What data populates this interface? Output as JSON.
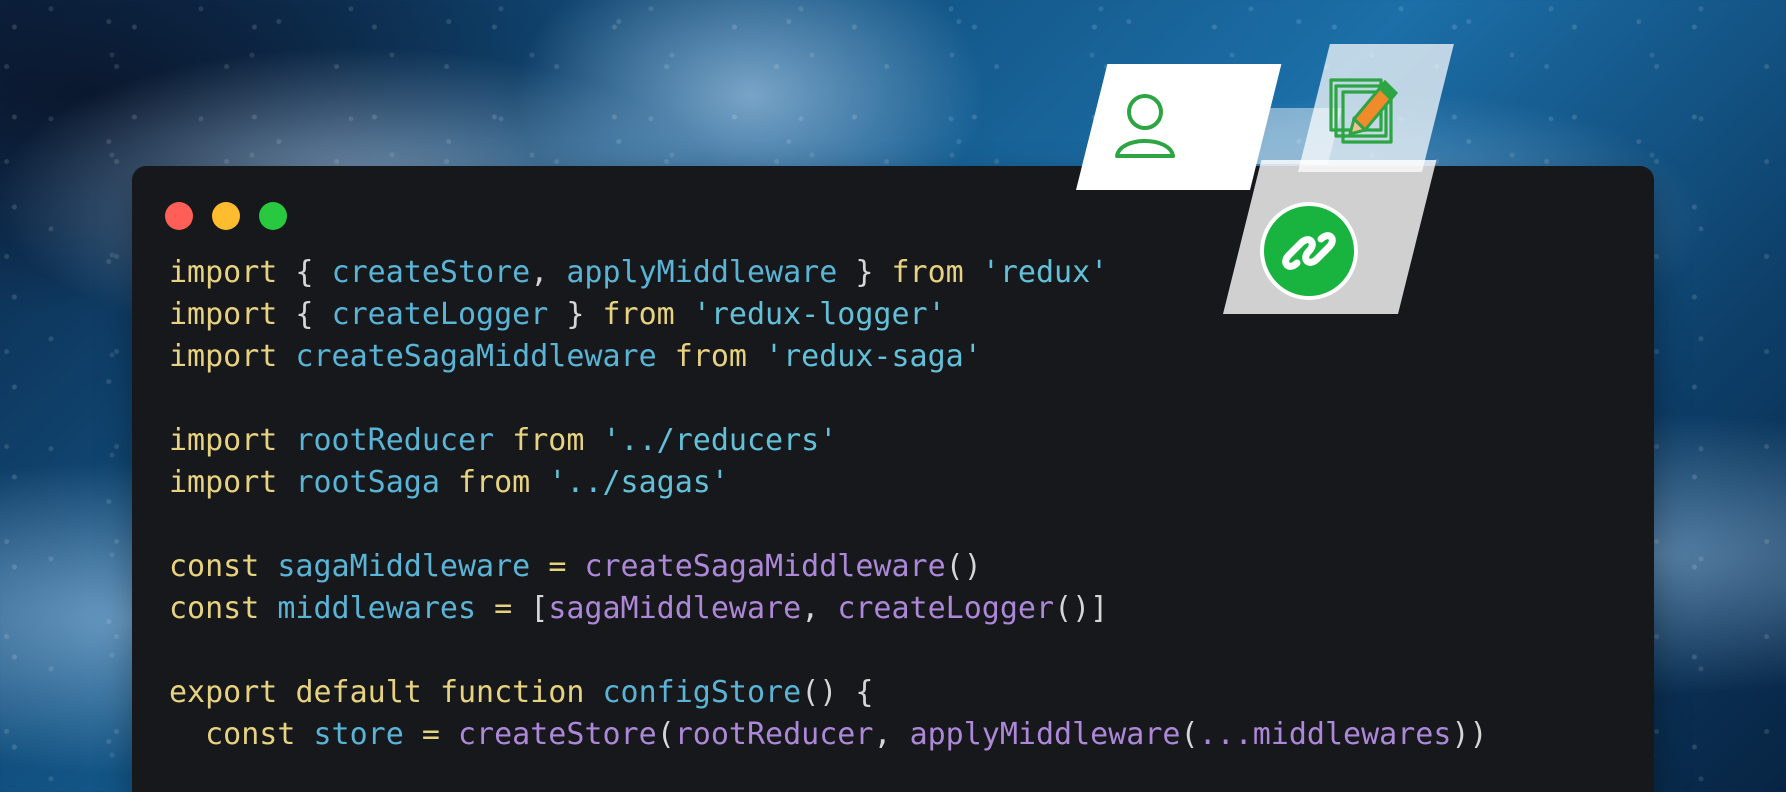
{
  "window": {
    "controls": [
      {
        "name": "close",
        "color": "#ff5f57"
      },
      {
        "name": "minimize",
        "color": "#febc2e"
      },
      {
        "name": "maximize",
        "color": "#28c840"
      }
    ]
  },
  "code": [
    [
      {
        "t": "import",
        "c": "kw"
      },
      {
        "t": " { ",
        "c": "punc"
      },
      {
        "t": "createStore",
        "c": "id"
      },
      {
        "t": ", ",
        "c": "punc"
      },
      {
        "t": "applyMiddleware",
        "c": "id"
      },
      {
        "t": " } ",
        "c": "punc"
      },
      {
        "t": "from",
        "c": "kw"
      },
      {
        "t": " ",
        "c": "punc"
      },
      {
        "t": "'redux'",
        "c": "str"
      }
    ],
    [
      {
        "t": "import",
        "c": "kw"
      },
      {
        "t": " { ",
        "c": "punc"
      },
      {
        "t": "createLogger",
        "c": "id"
      },
      {
        "t": " } ",
        "c": "punc"
      },
      {
        "t": "from",
        "c": "kw"
      },
      {
        "t": " ",
        "c": "punc"
      },
      {
        "t": "'redux-logger'",
        "c": "str"
      }
    ],
    [
      {
        "t": "import",
        "c": "kw"
      },
      {
        "t": " ",
        "c": "punc"
      },
      {
        "t": "createSagaMiddleware",
        "c": "id"
      },
      {
        "t": " ",
        "c": "punc"
      },
      {
        "t": "from",
        "c": "kw"
      },
      {
        "t": " ",
        "c": "punc"
      },
      {
        "t": "'redux-saga'",
        "c": "str"
      }
    ],
    [],
    [
      {
        "t": "import",
        "c": "kw"
      },
      {
        "t": " ",
        "c": "punc"
      },
      {
        "t": "rootReducer",
        "c": "id"
      },
      {
        "t": " ",
        "c": "punc"
      },
      {
        "t": "from",
        "c": "kw"
      },
      {
        "t": " ",
        "c": "punc"
      },
      {
        "t": "'../reducers'",
        "c": "str"
      }
    ],
    [
      {
        "t": "import",
        "c": "kw"
      },
      {
        "t": " ",
        "c": "punc"
      },
      {
        "t": "rootSaga",
        "c": "id"
      },
      {
        "t": " ",
        "c": "punc"
      },
      {
        "t": "from",
        "c": "kw"
      },
      {
        "t": " ",
        "c": "punc"
      },
      {
        "t": "'../sagas'",
        "c": "str"
      }
    ],
    [],
    [
      {
        "t": "const",
        "c": "kw"
      },
      {
        "t": " ",
        "c": "punc"
      },
      {
        "t": "sagaMiddleware",
        "c": "id"
      },
      {
        "t": " ",
        "c": "punc"
      },
      {
        "t": "=",
        "c": "kw"
      },
      {
        "t": " ",
        "c": "punc"
      },
      {
        "t": "createSagaMiddleware",
        "c": "fn"
      },
      {
        "t": "()",
        "c": "punc"
      }
    ],
    [
      {
        "t": "const",
        "c": "kw"
      },
      {
        "t": " ",
        "c": "punc"
      },
      {
        "t": "middlewares",
        "c": "id"
      },
      {
        "t": " ",
        "c": "punc"
      },
      {
        "t": "=",
        "c": "kw"
      },
      {
        "t": " [",
        "c": "punc"
      },
      {
        "t": "sagaMiddleware",
        "c": "fn"
      },
      {
        "t": ", ",
        "c": "punc"
      },
      {
        "t": "createLogger",
        "c": "fn"
      },
      {
        "t": "()]",
        "c": "punc"
      }
    ],
    [],
    [
      {
        "t": "export",
        "c": "kw"
      },
      {
        "t": " ",
        "c": "punc"
      },
      {
        "t": "default",
        "c": "kw"
      },
      {
        "t": " ",
        "c": "punc"
      },
      {
        "t": "function",
        "c": "kw"
      },
      {
        "t": " ",
        "c": "punc"
      },
      {
        "t": "configStore",
        "c": "id"
      },
      {
        "t": "() {",
        "c": "punc"
      }
    ],
    [
      {
        "t": "  ",
        "c": "punc"
      },
      {
        "t": "const",
        "c": "kw"
      },
      {
        "t": " ",
        "c": "punc"
      },
      {
        "t": "store",
        "c": "id"
      },
      {
        "t": " ",
        "c": "punc"
      },
      {
        "t": "=",
        "c": "kw"
      },
      {
        "t": " ",
        "c": "punc"
      },
      {
        "t": "createStore",
        "c": "fn"
      },
      {
        "t": "(",
        "c": "punc"
      },
      {
        "t": "rootReducer",
        "c": "fn"
      },
      {
        "t": ", ",
        "c": "punc"
      },
      {
        "t": "applyMiddleware",
        "c": "fn"
      },
      {
        "t": "(",
        "c": "punc"
      },
      {
        "t": "...middlewares",
        "c": "fn"
      },
      {
        "t": "))",
        "c": "punc"
      }
    ]
  ],
  "overlay_icons": [
    "user-icon",
    "notepad-pencil-icon",
    "link-icon"
  ]
}
